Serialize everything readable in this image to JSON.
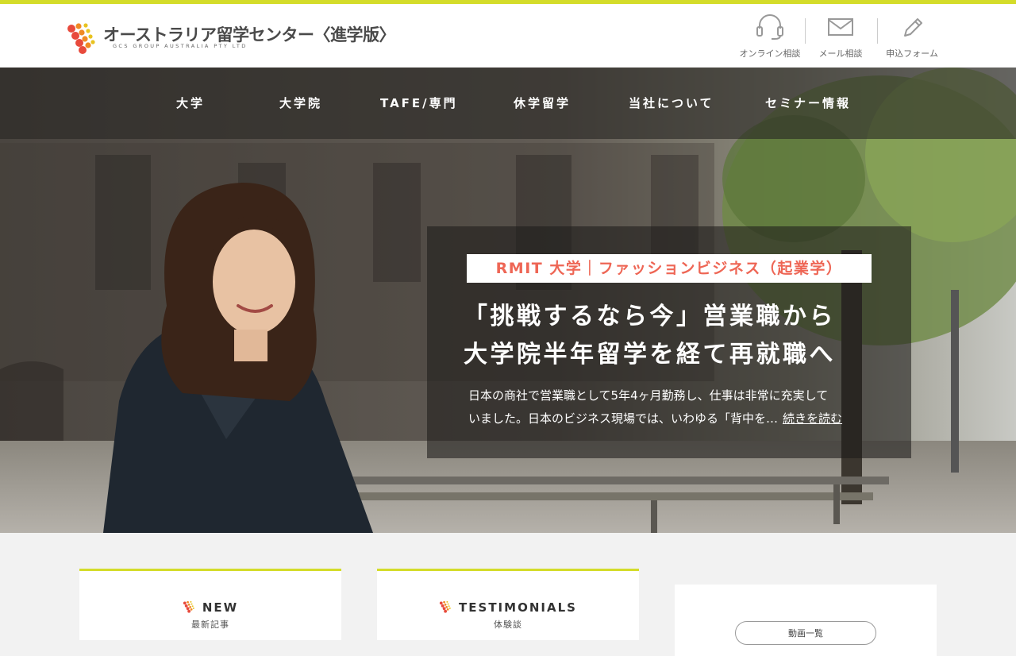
{
  "colors": {
    "accent": "#d4dc2a",
    "tag_text": "#ee6655",
    "header_bg": "#ffffff",
    "page_bg": "#f2f2f2"
  },
  "logo": {
    "title": "オーストラリア留学センター〈進学版〉",
    "subtitle": "GCS GROUP AUSTRALIA PTY LTD"
  },
  "contacts": [
    {
      "label": "オンライン相談",
      "icon": "headset-icon"
    },
    {
      "label": "メール相談",
      "icon": "mail-icon"
    },
    {
      "label": "申込フォーム",
      "icon": "pencil-icon"
    }
  ],
  "nav": {
    "items": [
      "大学",
      "大学院",
      "TAFE/専門",
      "休学留学",
      "当社について",
      "セミナー情報"
    ]
  },
  "hero": {
    "tag": "RMIT 大学｜ファッションビジネス（起業学）",
    "headline_1": "「挑戦するなら今」営業職から",
    "headline_2": "大学院半年留学を経て再就職へ",
    "excerpt_1": "日本の商社で営業職として5年4ヶ月勤務し、仕事は非常に充実して",
    "excerpt_2": "いました。日本のビジネス現場では、いわゆる「背中を…",
    "read_more": "続きを読む"
  },
  "sections": [
    {
      "title": "NEW",
      "subtitle": "最新記事"
    },
    {
      "title": "TESTIMONIALS",
      "subtitle": "体験談"
    },
    {
      "button": "動画一覧"
    }
  ]
}
